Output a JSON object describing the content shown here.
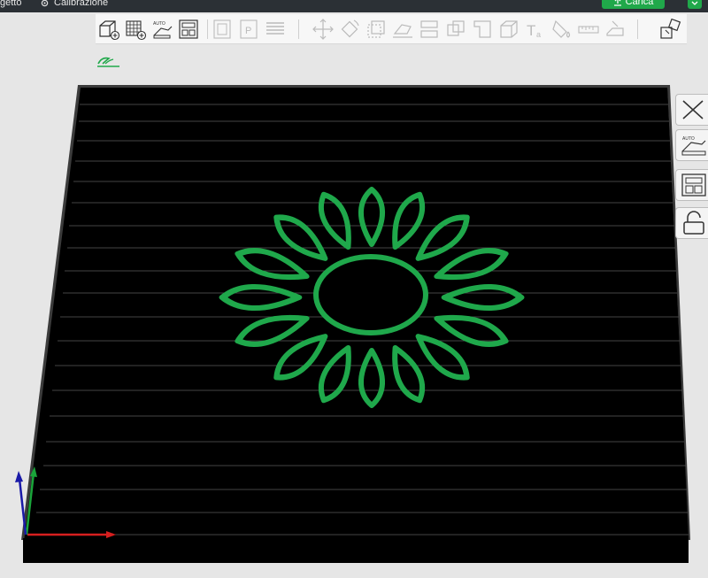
{
  "menubar": {
    "project_label": "getto",
    "calibration_label": "Calibrazione"
  },
  "topbar": {
    "load_label": "Carica"
  },
  "toolbar": {
    "buttons": [
      "add-cube-icon",
      "add-plate-icon",
      "auto-orient-icon",
      "arrange-icon",
      "object-list-icon",
      "plate-list-icon",
      "layers-icon",
      "move-icon",
      "rotate-icon",
      "scale-icon",
      "lay-on-face-icon",
      "split-objects-icon",
      "split-parts-icon",
      "cut-icon",
      "variable-layer-icon",
      "text-icon",
      "paint-icon",
      "measure-icon",
      "seam-icon",
      "assembly-icon"
    ]
  },
  "colors": {
    "accent": "#20a84a",
    "bed": "#000000",
    "model": "#1fa84b",
    "axis_x": "#d61f1f",
    "axis_y": "#1aa53a",
    "axis_z": "#1a1aa8"
  },
  "scene": {
    "model": "sunflower-outline"
  },
  "side_toolbar": [
    "close-icon",
    "auto-orient-plate-icon",
    "arrange-plate-icon",
    "lock-icon"
  ]
}
